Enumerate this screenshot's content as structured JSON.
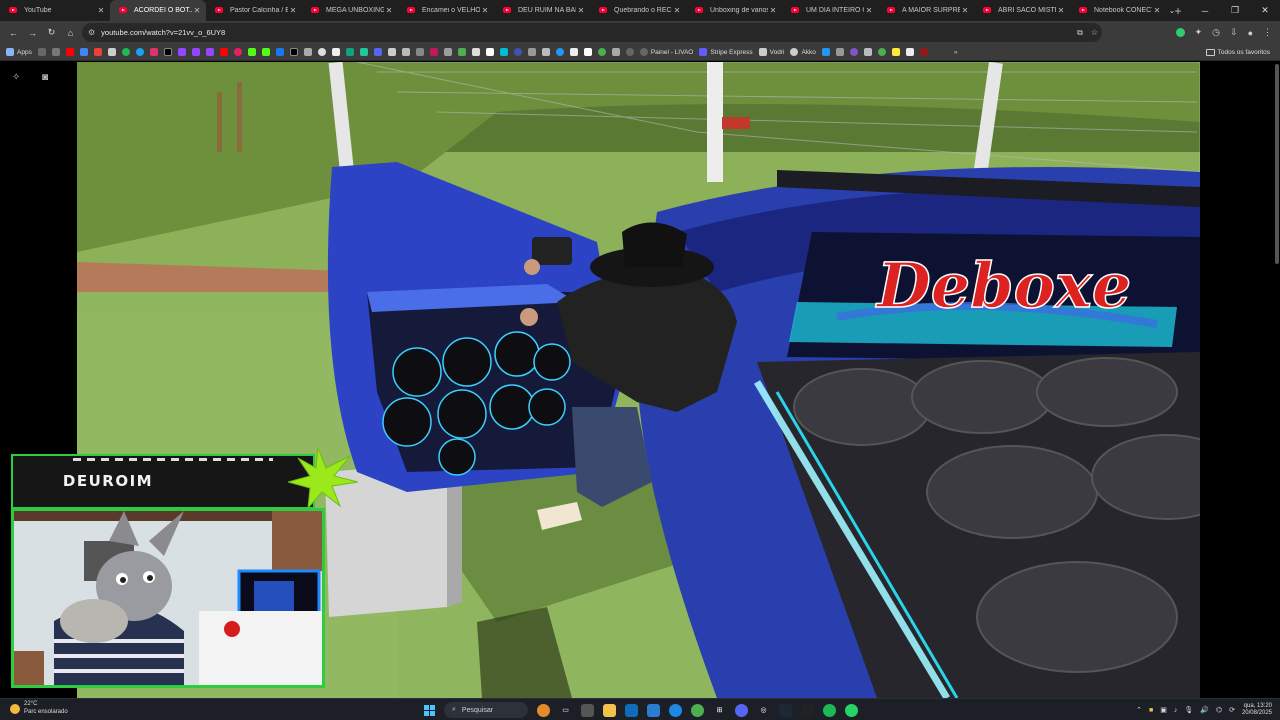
{
  "browser": {
    "tabs": [
      {
        "title": "YouTube",
        "active": false
      },
      {
        "title": "ACORDEI O BOT...",
        "active": true
      },
      {
        "title": "Pastor Calcinha / Bo",
        "active": false
      },
      {
        "title": "MEGA UNBOXING #",
        "active": false
      },
      {
        "title": "Encamei o VELHO c",
        "active": false
      },
      {
        "title": "DEU RUIM NA BAL",
        "active": false
      },
      {
        "title": "Quebrando o RECO",
        "active": false
      },
      {
        "title": "Unboxing de varios",
        "active": false
      },
      {
        "title": "UM DIA INTEIRO CO",
        "active": false
      },
      {
        "title": "A MAIOR SURPRES",
        "active": false
      },
      {
        "title": "ABRI SACO MISTERI",
        "active": false
      },
      {
        "title": "Notebook CONECTA",
        "active": false
      }
    ],
    "url": "youtube.com/watch?v=21vv_o_6UY8",
    "bookmarks": {
      "apps_label": "Apps",
      "named": [
        "Painel - LIVAO",
        "Stripe Express",
        "Vodri",
        "Akko"
      ],
      "all_favorites": "Todos os favoritos"
    }
  },
  "video": {
    "overlay_name": "DEUROIM",
    "car_decal": "Deboxe"
  },
  "taskbar": {
    "weather_temp": "22°C",
    "weather_desc": "Parc ensolarado",
    "search_label": "Pesquisar",
    "time": "qua, 13:20",
    "date": "20/08/2025"
  },
  "colors": {
    "overlay_green": "#2ecc40",
    "youtube_red": "#ff0033",
    "car_blue": "#2a3fae"
  }
}
